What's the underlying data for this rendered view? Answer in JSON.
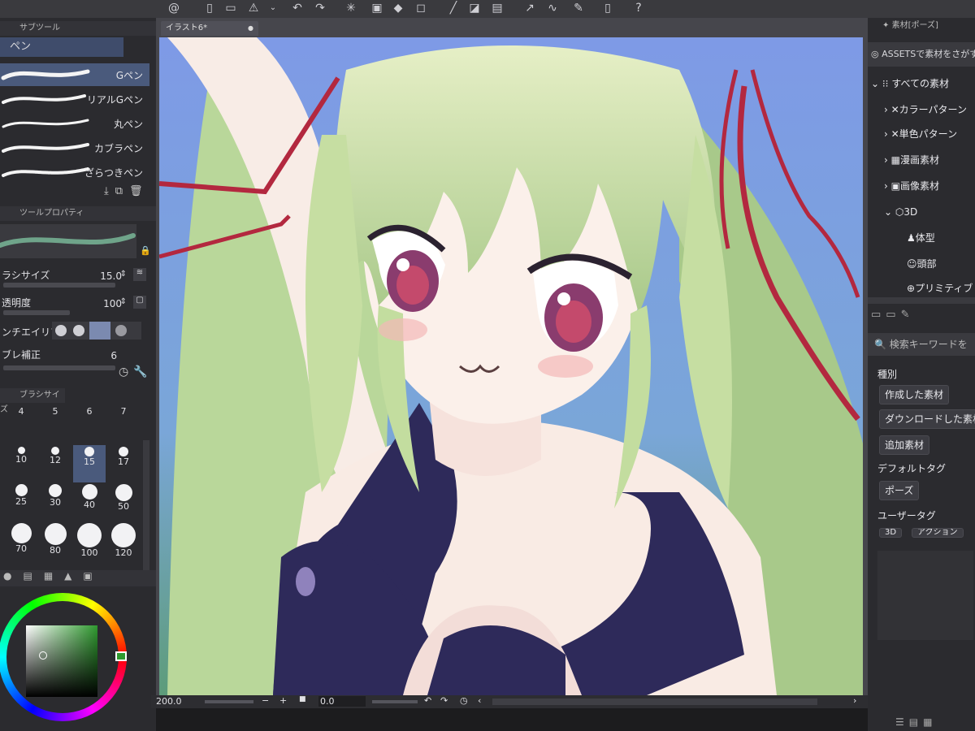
{
  "topbar": {
    "icons": [
      "spiral-logo-icon",
      "new-icon",
      "open-icon",
      "save-icon",
      "warning-icon",
      "dropdown-icon",
      "undo-icon",
      "redo-icon",
      "loading-icon",
      "clear-icon",
      "fill-icon",
      "transform-icon",
      "snap-icon",
      "grid-icon",
      "ruler-icon",
      "pen-pressure-icon",
      "smoothing-icon",
      "edit-icon",
      "tablet-icon",
      "help-icon"
    ]
  },
  "subtool": {
    "title": "サブツール",
    "group": "ペン",
    "brushes": [
      "Gペン",
      "リアルGペン",
      "丸ペン",
      "カブラペン",
      "ざらつきペン"
    ]
  },
  "tool_property": {
    "title": "ツールプロパティ",
    "brush_size": {
      "label": "ブラシサイズ",
      "display_label": "ラシサイズ",
      "value": "15.0"
    },
    "opacity": {
      "label": "不透明度",
      "display_label": "透明度",
      "value": "100"
    },
    "antialias": {
      "display_label": "ンチエイリアス"
    },
    "stabilization": {
      "display_label": "ブレ補正",
      "value": "6"
    }
  },
  "brush_size_panel": {
    "title": "ブラシサイズ",
    "sizes": [
      "4",
      "5",
      "6",
      "7",
      "10",
      "12",
      "15",
      "17",
      "25",
      "30",
      "40",
      "50",
      "70",
      "80",
      "100",
      "120"
    ],
    "selected": "15"
  },
  "canvas": {
    "tab_title": "イラスト6*",
    "zoom": "200.0",
    "rotation": "0.0"
  },
  "materials": {
    "panel_title": "素材[ポーズ]",
    "assets_search": "ASSETSで素材をさがす",
    "tree": {
      "all": "すべての素材",
      "color_pattern": "カラーパターン",
      "mono_pattern": "単色パターン",
      "manga": "漫画素材",
      "image": "画像素材",
      "three_d": "3D",
      "body": "体型",
      "head": "頭部",
      "primitive": "プリミティブ"
    },
    "search_placeholder": "検索キーワードを",
    "type_label": "種別",
    "created": "作成した素材",
    "downloaded": "ダウンロードした素材",
    "added": "追加素材",
    "default_tag_label": "デフォルトタグ",
    "pose_tag": "ポーズ",
    "user_tag_label": "ユーザータグ",
    "user_tags": [
      "3D",
      "アクション"
    ]
  },
  "colors": {
    "accent": "#4a5a7c",
    "bg": "#2b2b2f",
    "hair": "#d7e6b0",
    "ribbon": "#b3283f",
    "swimsuit": "#2e2a5a",
    "sky": "#7e9ae6"
  }
}
